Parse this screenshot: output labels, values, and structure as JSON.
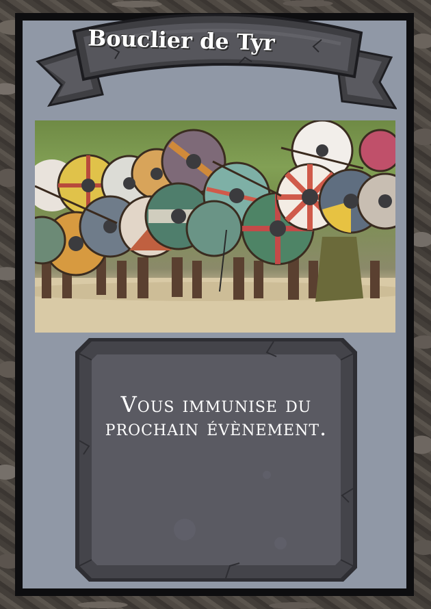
{
  "card": {
    "title": "Bouclier de Tyr",
    "description": "Vous immunise du prochain évènement.",
    "image": "viking-shield-wall-photo",
    "colors": {
      "frame": "#0d0d0f",
      "panel": "#9098a6",
      "banner": "#545458",
      "textbox": "#585860",
      "text": "#ffffff"
    }
  }
}
